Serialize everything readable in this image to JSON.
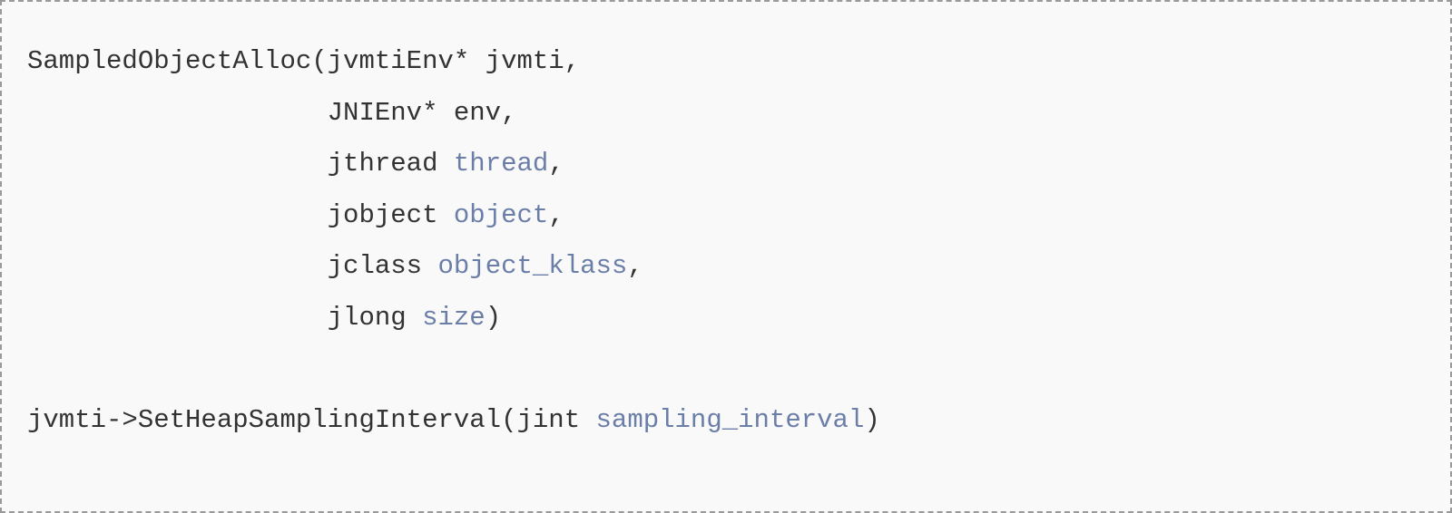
{
  "code": {
    "l1_a": "SampledObjectAlloc(jvmtiEnv* jvmti,",
    "l2_a": "                   JNIEnv* env,",
    "l3_a": "                   jthread ",
    "l3_p": "thread",
    "l3_b": ",",
    "l4_a": "                   jobject ",
    "l4_p": "object",
    "l4_b": ",",
    "l5_a": "                   jclass ",
    "l5_p": "object_klass",
    "l5_b": ",",
    "l6_a": "                   jlong ",
    "l6_p": "size",
    "l6_b": ")",
    "blank": "",
    "l8_a": "jvmti->SetHeapSamplingInterval(jint ",
    "l8_p": "sampling_interval",
    "l8_b": ")"
  }
}
